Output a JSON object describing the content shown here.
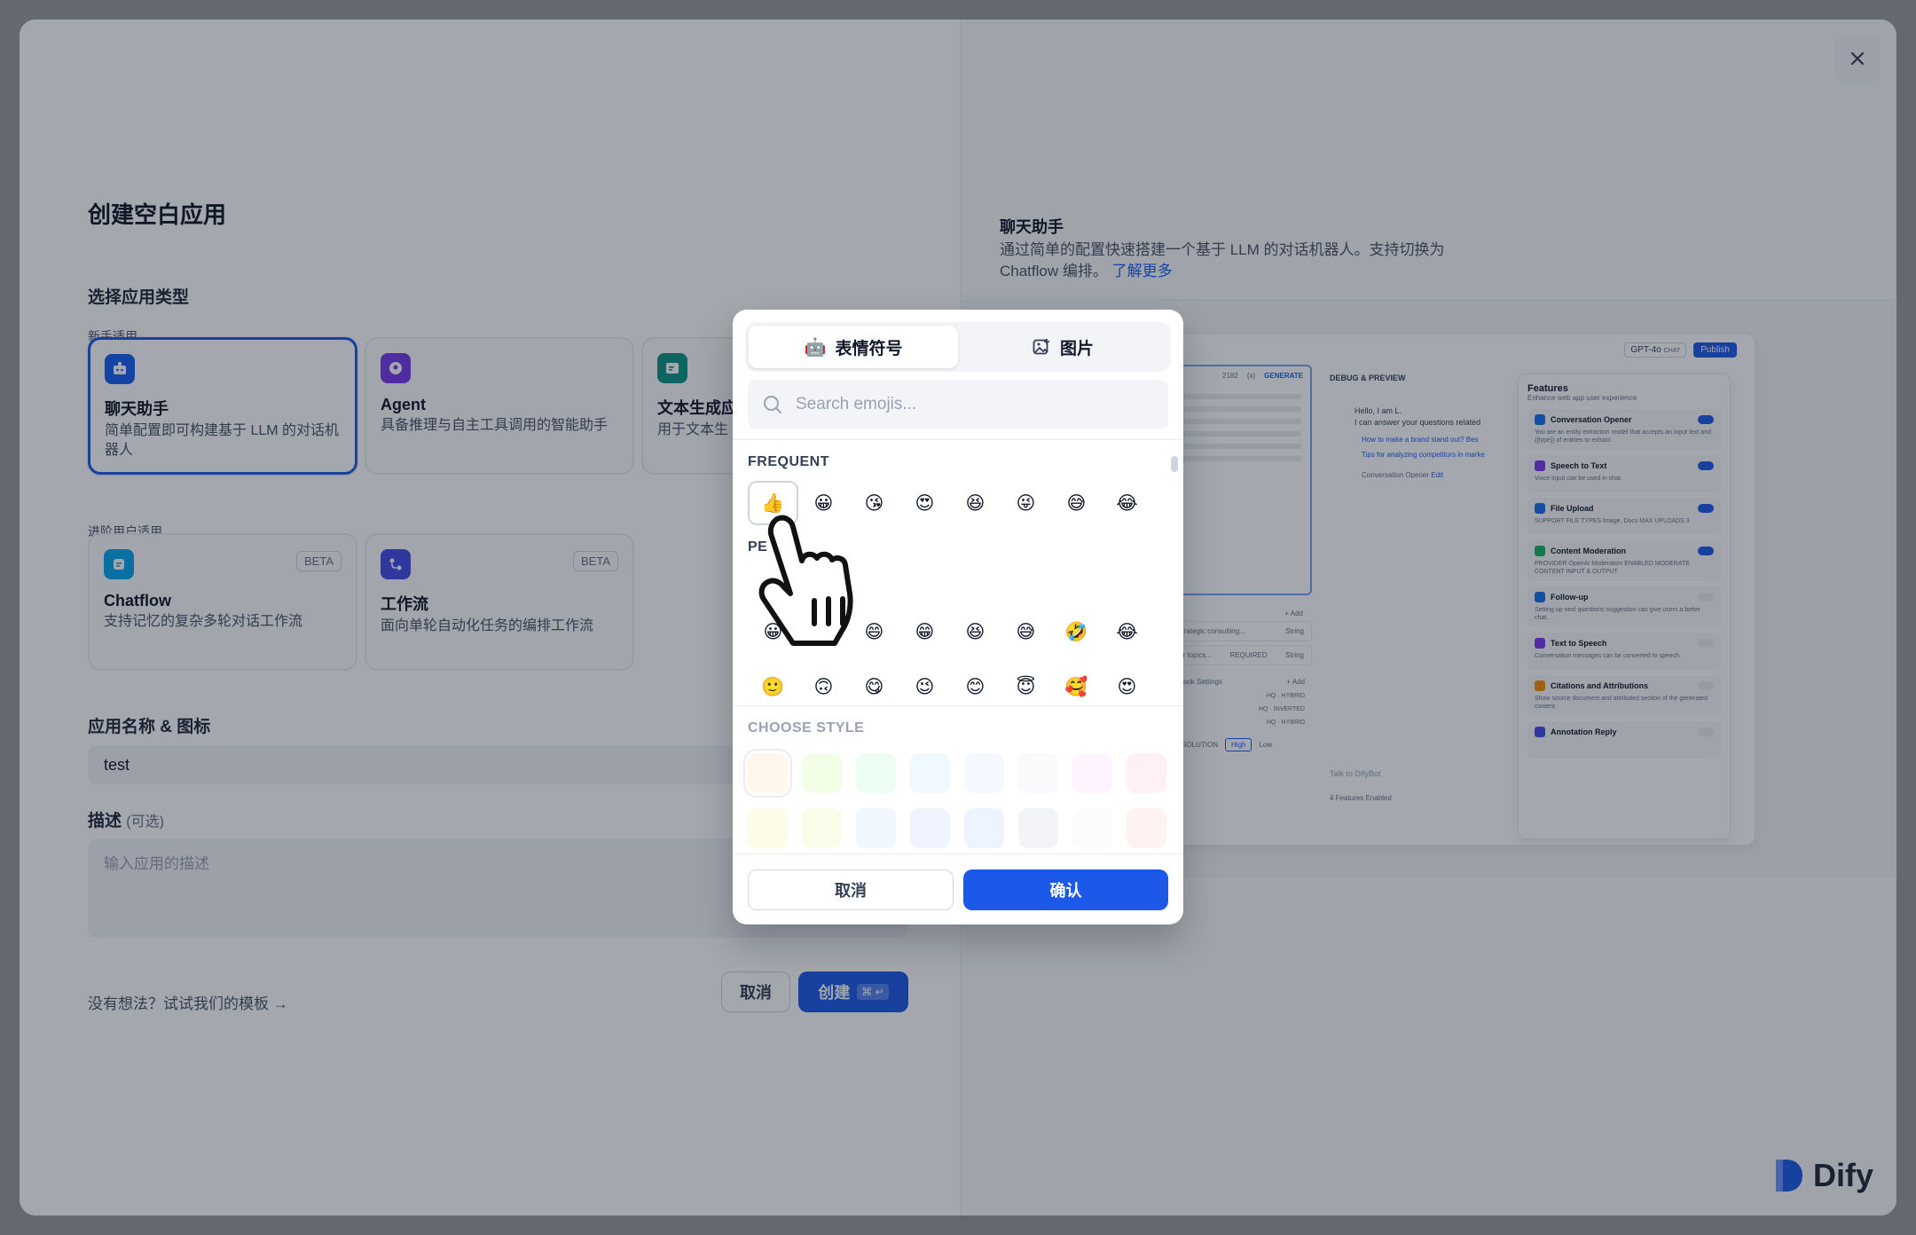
{
  "page": {
    "title": "创建空白应用",
    "section_app_type": "选择应用类型",
    "group_beginner": "新手适用",
    "group_advanced": "进阶用户适用",
    "section_name_icon": "应用名称 & 图标",
    "name_value": "test",
    "section_desc": "描述",
    "section_desc_optional": "(可选)",
    "desc_placeholder": "输入应用的描述",
    "bottom_hint": "没有想法？试试我们的模板 →",
    "cancel_label": "取消",
    "create_label": "创建",
    "create_kbd": "⌘ ↵"
  },
  "app_types": {
    "beginner": [
      {
        "name": "聊天助手",
        "desc": "简单配置即可构建基于 LLM 的对话机器人",
        "color": "#155eef"
      },
      {
        "name": "Agent",
        "desc": "具备推理与自主工具调用的智能助手",
        "color": "#7839ee"
      },
      {
        "name": "文本生成应",
        "desc": "用于文本生",
        "color": "#0e9384"
      }
    ],
    "advanced": [
      {
        "name": "Chatflow",
        "desc": "支持记忆的复杂多轮对话工作流",
        "badge": "BETA",
        "color": "#0ba5ec"
      },
      {
        "name": "工作流",
        "desc": "面向单轮自动化任务的编排工作流",
        "badge": "BETA",
        "color": "#444ce7"
      }
    ]
  },
  "right_panel": {
    "title": "聊天助手",
    "desc": "通过简单的配置快速搭建一个基于 LLM 的对话机器人。支持切换为 Chatflow 编排。",
    "link": "了解更多",
    "logo_text": "Dify",
    "preview": {
      "model": "GPT-4o",
      "model_tag": "CHAT",
      "publish": "Publish",
      "num": "2182",
      "var": "{x}",
      "generate": "GENERATE",
      "debug": "DEBUG & PREVIEW",
      "bot_greeting": "Hello, I am L.",
      "bot_line": "I can answer your questions related",
      "suggest_1": "How to make a brand stand out?",
      "suggest_1_trunc": "Bes",
      "suggest_2": "Tips for analyzing competitors in marke",
      "opener_hint": "Conversation Opener",
      "opener_edit": "Edit",
      "add_label": "+ Add",
      "var_1": "e strategic consulting...",
      "var_1_type": "String",
      "var_2": "r for topics...",
      "var_2_req": "REQUIRED",
      "var_2_type": "String",
      "rerank": "Rerank Settings",
      "hybrid_1": "HQ · HYBRID",
      "inverted": "HQ · INVERTED",
      "hybrid_2": "HQ · HYBRID",
      "resolution": "RESOLUTION",
      "res_high": "High",
      "res_low": "Low",
      "talk_placeholder": "Talk to DifyBot",
      "features_enabled": "4 Features Enabled",
      "features_title": "Features",
      "features_sub": "Enhance web app user experience",
      "features": [
        {
          "name": "Conversation Opener",
          "desc": "You are an entity extraction model that accepts an input text and {{type}} of entities to extract.",
          "on": true,
          "color": "#1570ef"
        },
        {
          "name": "Speech to Text",
          "desc": "Voice input can be used in chat.",
          "on": true,
          "color": "#7839ee"
        },
        {
          "name": "File Upload",
          "desc": "SUPPORT FILE TYPES  Image, Docs   MAX UPLOADS 3",
          "on": true,
          "color": "#1570ef"
        },
        {
          "name": "Content Moderation",
          "desc": "PROVIDER OpenAI Moderation   ENABLED MODERATE CONTENT INPUT & OUTPUT",
          "on": true,
          "color": "#16b364"
        },
        {
          "name": "Follow-up",
          "desc": "Setting up next questions suggestion can give users a better chat.",
          "on": false,
          "color": "#1570ef"
        },
        {
          "name": "Text to Speech",
          "desc": "Conversation messages can be converted to speech.",
          "on": false,
          "color": "#7839ee"
        },
        {
          "name": "Citations and Attributions",
          "desc": "Show source document and attributed section of the generated content.",
          "on": false,
          "color": "#f79009"
        },
        {
          "name": "Annotation Reply",
          "desc": "",
          "on": false,
          "color": "#444ce7"
        }
      ]
    }
  },
  "emoji_picker": {
    "tab_emoji": "表情符号",
    "tab_image": "图片",
    "tab_emoji_icon": "🤖",
    "search_placeholder": "Search emojis...",
    "group_frequent": "FREQUENT",
    "group_people": "PE",
    "frequent": [
      "👍",
      "😀",
      "😘",
      "😍",
      "😆",
      "😜",
      "😅",
      "😂"
    ],
    "people_row1": [
      "😀",
      "😃",
      "😄",
      "😁",
      "😆",
      "😅",
      "🤣",
      "😂"
    ],
    "people_row2": [
      "🙂",
      "🙃",
      "😋",
      "😉",
      "😊",
      "😇",
      "🥰",
      "😍"
    ],
    "style_label": "CHOOSE STYLE",
    "swatches_row1": [
      "#fff6ed",
      "#f3fee7",
      "#ecfdf3",
      "#f0f9ff",
      "#f5f8ff",
      "#f9fafb",
      "#fdf4ff",
      "#fff1f3"
    ],
    "swatches_row2": [
      "#fefbe8",
      "#f7fde8",
      "#eff8ff",
      "#eff4ff",
      "#eef4ff",
      "#f2f4f7",
      "#fcfcfd",
      "#fef3f2"
    ],
    "cancel": "取消",
    "confirm": "确认"
  }
}
